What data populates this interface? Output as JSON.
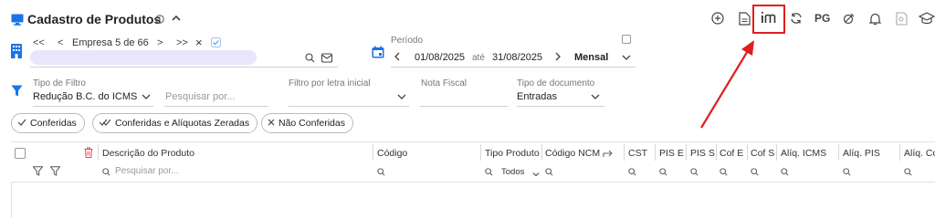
{
  "header": {
    "title": "Cadastro de Produtos",
    "toolbar": {
      "pg_label": "PG"
    }
  },
  "empresa": {
    "label": "Empresa 5 de 66",
    "first": "<<",
    "prev": "<",
    "next": ">",
    "last": ">>",
    "clear": "×"
  },
  "periodo": {
    "label": "Período",
    "start": "01/08/2025",
    "sep": "até",
    "end": "31/08/2025",
    "mode": "Mensal"
  },
  "filters": {
    "tipo_filtro_label": "Tipo de Filtro",
    "tipo_filtro_value": "Redução B.C. do ICMS",
    "pesquisar_placeholder": "Pesquisar por...",
    "letra_label": "Filtro por letra inicial",
    "nota_label": "Nota Fiscal",
    "tipo_doc_label": "Tipo de documento",
    "tipo_doc_value": "Entradas"
  },
  "chips": [
    {
      "label": "Conferidas"
    },
    {
      "label": "Conferidas e Alíquotas Zeradas"
    },
    {
      "label": "Não Conferidas"
    }
  ],
  "table": {
    "columns": {
      "descricao": "Descrição do Produto",
      "codigo": "Código",
      "tipo": "Tipo Produto",
      "ncm": "Código NCM",
      "cst": "CST",
      "pis_e": "PIS E",
      "pis_s": "PIS S",
      "cof_e": "Cof E",
      "cof_s": "Cof S",
      "aliq_icms": "Alíq. ICMS",
      "aliq_pis": "Alíq. PIS",
      "aliq_co": "Alíq. Co"
    },
    "search_placeholder": "Pesquisar por...",
    "tipo_filter_value": "Todos"
  },
  "colors": {
    "brand_blue": "#1a73e8",
    "annotation_red": "#e11d1d",
    "empresa_field": "#e8e6fb"
  }
}
